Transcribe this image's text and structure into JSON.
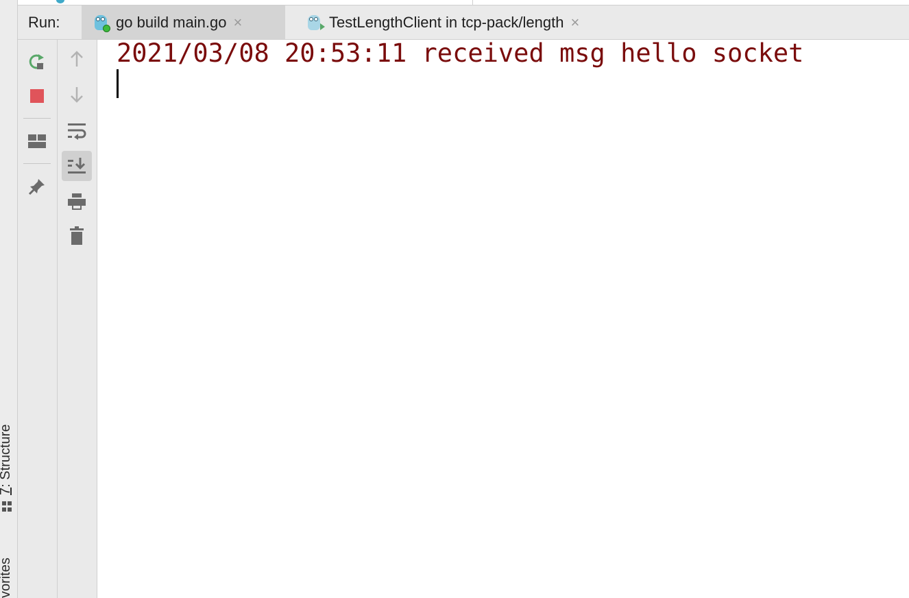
{
  "left_strip": {
    "structure_label_prefix": "7",
    "structure_label_rest": ": Structure",
    "favorites_label": "vorites"
  },
  "run_panel": {
    "run_label": "Run:",
    "tabs": [
      {
        "title": "go build main.go",
        "close": "×",
        "active": true,
        "icon": "go-gopher-run-icon"
      },
      {
        "title": "TestLengthClient in tcp-pack/length",
        "close": "×",
        "active": false,
        "icon": "go-gopher-test-icon"
      }
    ]
  },
  "toolbar_1": [
    {
      "name": "rerun-icon",
      "color": "#59a869"
    },
    {
      "name": "stop-icon",
      "color": "#e0545a"
    },
    {
      "name": "layout-icon",
      "color": "#6b6b6b"
    },
    {
      "name": "pin-icon",
      "color": "#6b6b6b"
    }
  ],
  "toolbar_2": [
    {
      "name": "arrow-up-icon",
      "color": "#b3b3b3"
    },
    {
      "name": "arrow-down-icon",
      "color": "#b3b3b3"
    },
    {
      "name": "soft-wrap-icon",
      "color": "#6b6b6b"
    },
    {
      "name": "scroll-to-end-icon",
      "color": "#6b6b6b",
      "pressed": true
    },
    {
      "name": "print-icon",
      "color": "#6b6b6b"
    },
    {
      "name": "trash-icon",
      "color": "#6b6b6b"
    }
  ],
  "console": {
    "lines": [
      "2021/03/08 20:53:11 received msg hello socket"
    ],
    "text_color": "#7a0c0c"
  }
}
